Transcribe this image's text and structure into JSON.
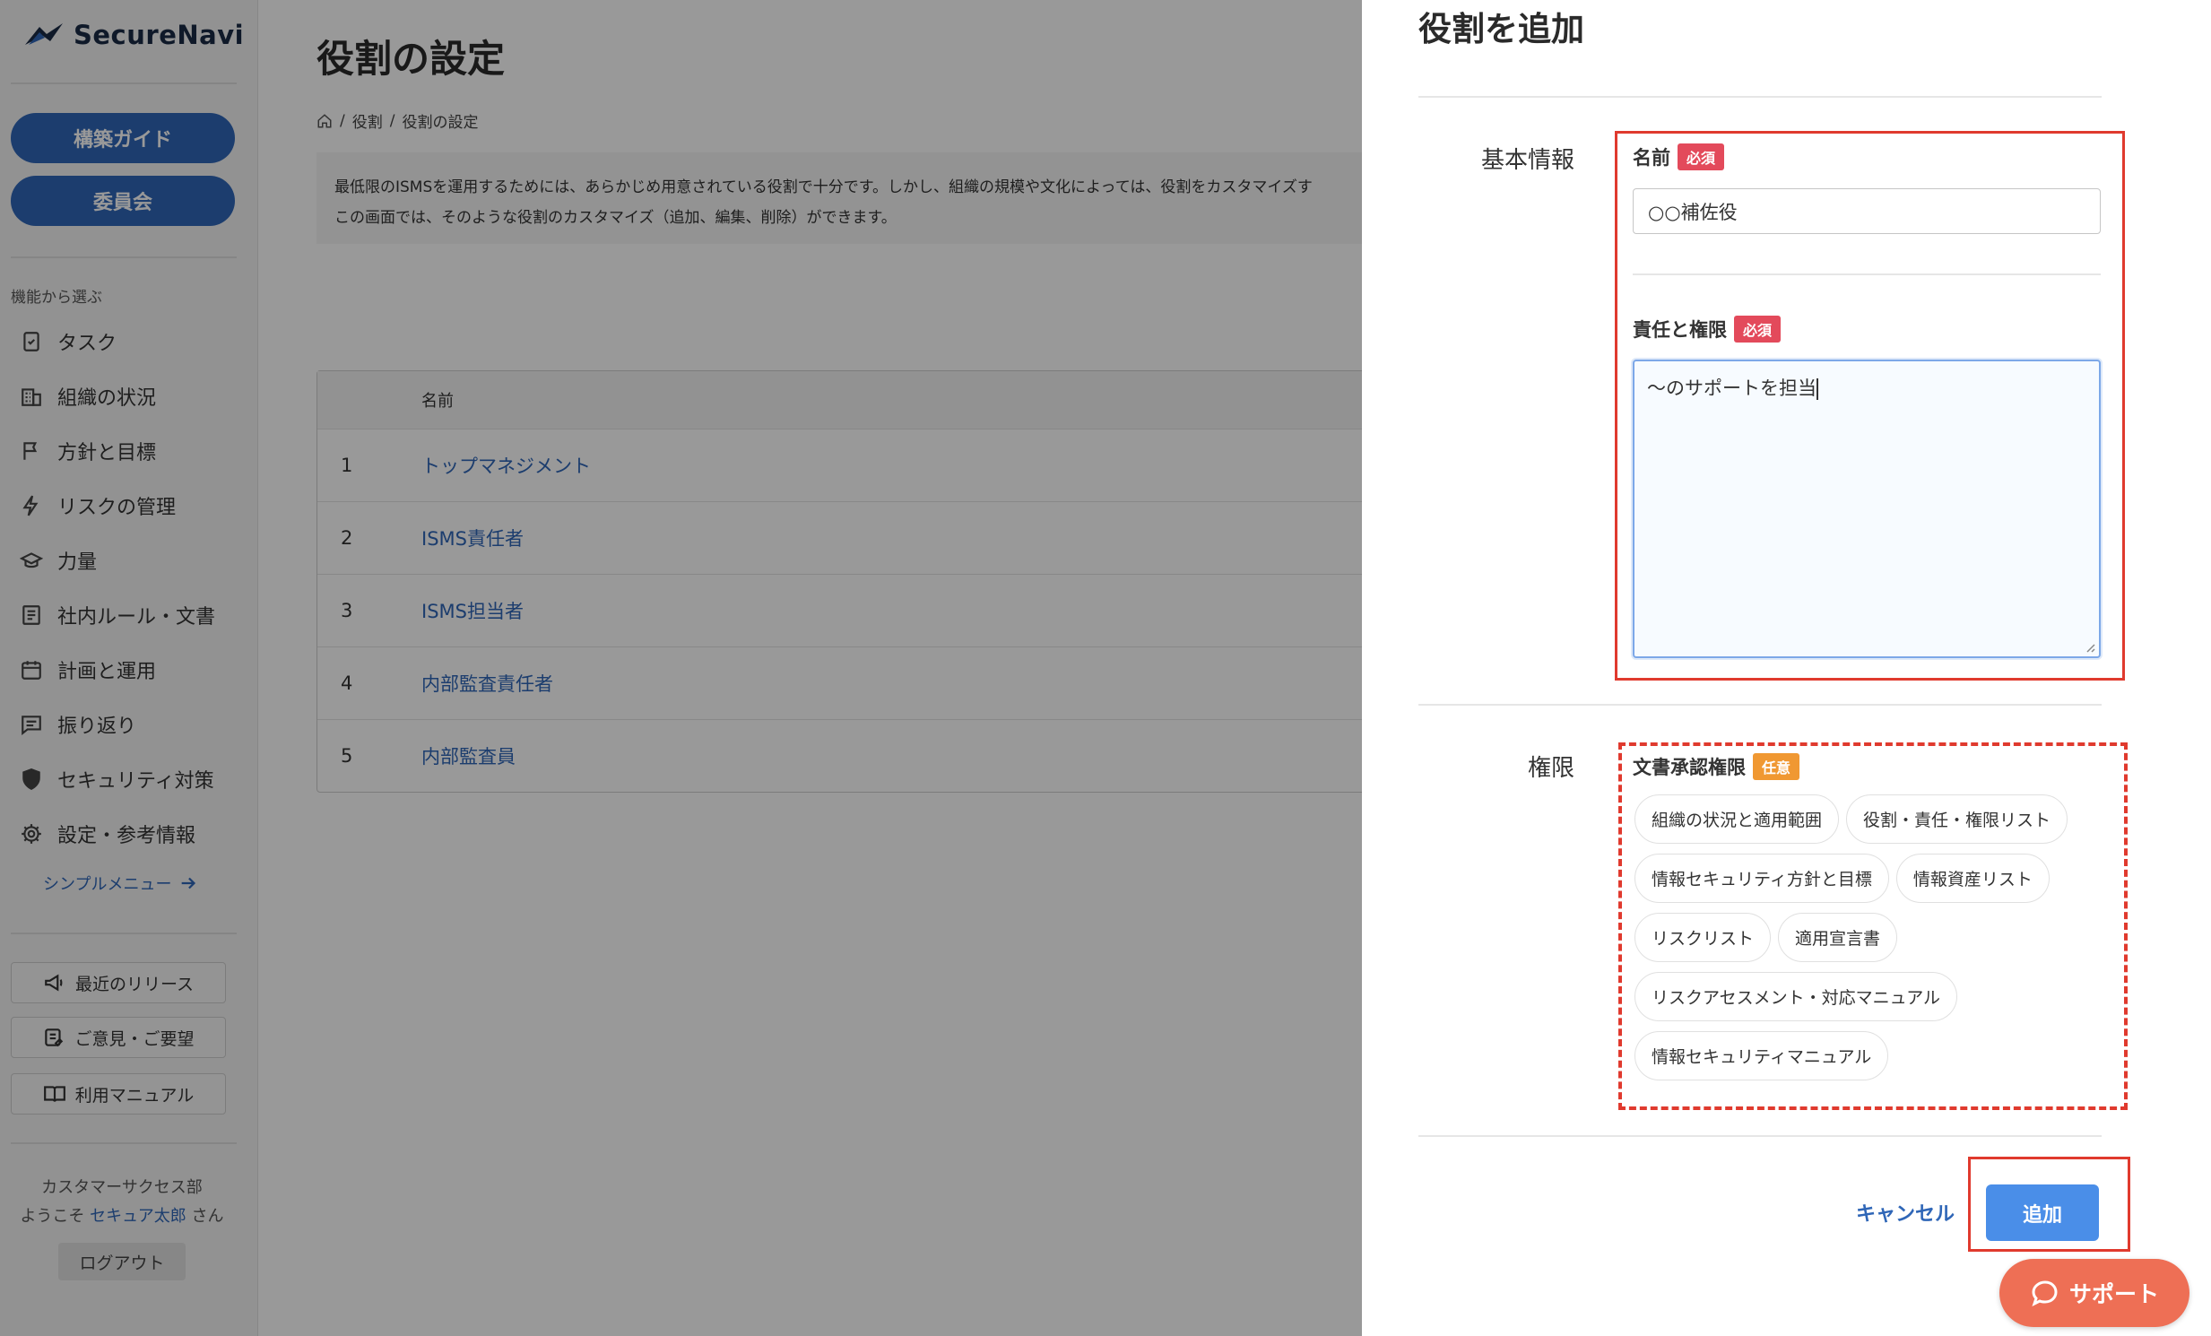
{
  "sidebar": {
    "logo": "SecureNavi",
    "guide_button": "構築ガイド",
    "committee_button": "委員会",
    "section_caption": "機能から選ぶ",
    "items": [
      {
        "label": "タスク",
        "icon": "task-check-icon"
      },
      {
        "label": "組織の状況",
        "icon": "building-icon"
      },
      {
        "label": "方針と目標",
        "icon": "flag-icon"
      },
      {
        "label": "リスクの管理",
        "icon": "lightning-icon"
      },
      {
        "label": "力量",
        "icon": "graduation-cap-icon"
      },
      {
        "label": "社内ルール・文書",
        "icon": "document-icon"
      },
      {
        "label": "計画と運用",
        "icon": "calendar-icon"
      },
      {
        "label": "振り返り",
        "icon": "comment-icon"
      },
      {
        "label": "セキュリティ対策",
        "icon": "shield-icon"
      },
      {
        "label": "設定・参考情報",
        "icon": "gear-icon"
      }
    ],
    "simple_menu": "シンプルメニュー",
    "releases": "最近のリリース",
    "feedback": "ご意見・ご要望",
    "manual": "利用マニュアル",
    "department": "カスタマーサクセス部",
    "welcome_prefix": "ようこそ",
    "user_name": "セキュア太郎",
    "welcome_suffix": "さん",
    "logout": "ログアウト"
  },
  "main": {
    "title": "役割の設定",
    "breadcrumb": [
      "役割",
      "役割の設定"
    ],
    "notice_line1": "最低限のISMSを運用するためには、あらかじめ用意されている役割で十分です。しかし、組織の規模や文化によっては、役割をカスタマイズす",
    "notice_line2": "この画面では、そのような役割のカスタマイズ（追加、編集、削除）ができます。",
    "table_header_name": "名前",
    "rows": [
      {
        "no": "1",
        "name": "トップマネジメント"
      },
      {
        "no": "2",
        "name": "ISMS責任者"
      },
      {
        "no": "3",
        "name": "ISMS担当者"
      },
      {
        "no": "4",
        "name": "内部監査責任者"
      },
      {
        "no": "5",
        "name": "内部監査員"
      }
    ]
  },
  "drawer": {
    "title": "役割を追加",
    "basic_section": "基本情報",
    "name_label": "名前",
    "required_badge": "必須",
    "name_value": "○○補佐役",
    "resp_label": "責任と権限",
    "resp_value": "〜のサポートを担当",
    "perm_section": "権限",
    "approval_label": "文書承認権限",
    "optional_badge": "任意",
    "chips": [
      [
        "組織の状況と適用範囲",
        "役割・責任・権限リスト"
      ],
      [
        "情報セキュリティ方針と目標",
        "情報資産リスト"
      ],
      [
        "リスクリスト",
        "適用宣言書"
      ],
      [
        "リスクアセスメント・対応マニュアル"
      ],
      [
        "情報セキュリティマニュアル"
      ]
    ],
    "cancel": "キャンセル",
    "add": "追加"
  },
  "support": "サポート",
  "colors": {
    "accent_blue": "#2f66b7",
    "primary_button": "#4a8ee8",
    "required_badge": "#e34a5b",
    "optional_badge": "#f09832",
    "support_button": "#ee6f55",
    "annotation_red": "#e03a2e"
  }
}
